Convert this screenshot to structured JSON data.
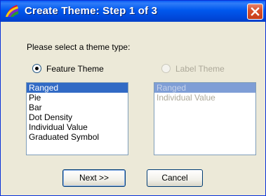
{
  "window": {
    "title": "Create Theme: Step 1 of 3"
  },
  "prompt": "Please select a theme type:",
  "radios": {
    "feature": {
      "label": "Feature Theme",
      "checked": true,
      "enabled": true
    },
    "label": {
      "label": "Label Theme",
      "checked": false,
      "enabled": false
    }
  },
  "feature_list": {
    "items": [
      "Ranged",
      "Pie",
      "Bar",
      "Dot Density",
      "Individual Value",
      "Graduated Symbol"
    ],
    "selected": "Ranged"
  },
  "label_list": {
    "items": [
      "Ranged",
      "Individual Value"
    ],
    "selected": "Ranged",
    "enabled": false
  },
  "buttons": {
    "next": "Next >>",
    "cancel": "Cancel"
  },
  "colors": {
    "title_bar": "#0054e3",
    "selection": "#316ac5",
    "close_button": "#d8502c",
    "dialog_bg": "#ece9d8"
  },
  "icons": {
    "app": "theme-icon",
    "close": "close-icon"
  }
}
